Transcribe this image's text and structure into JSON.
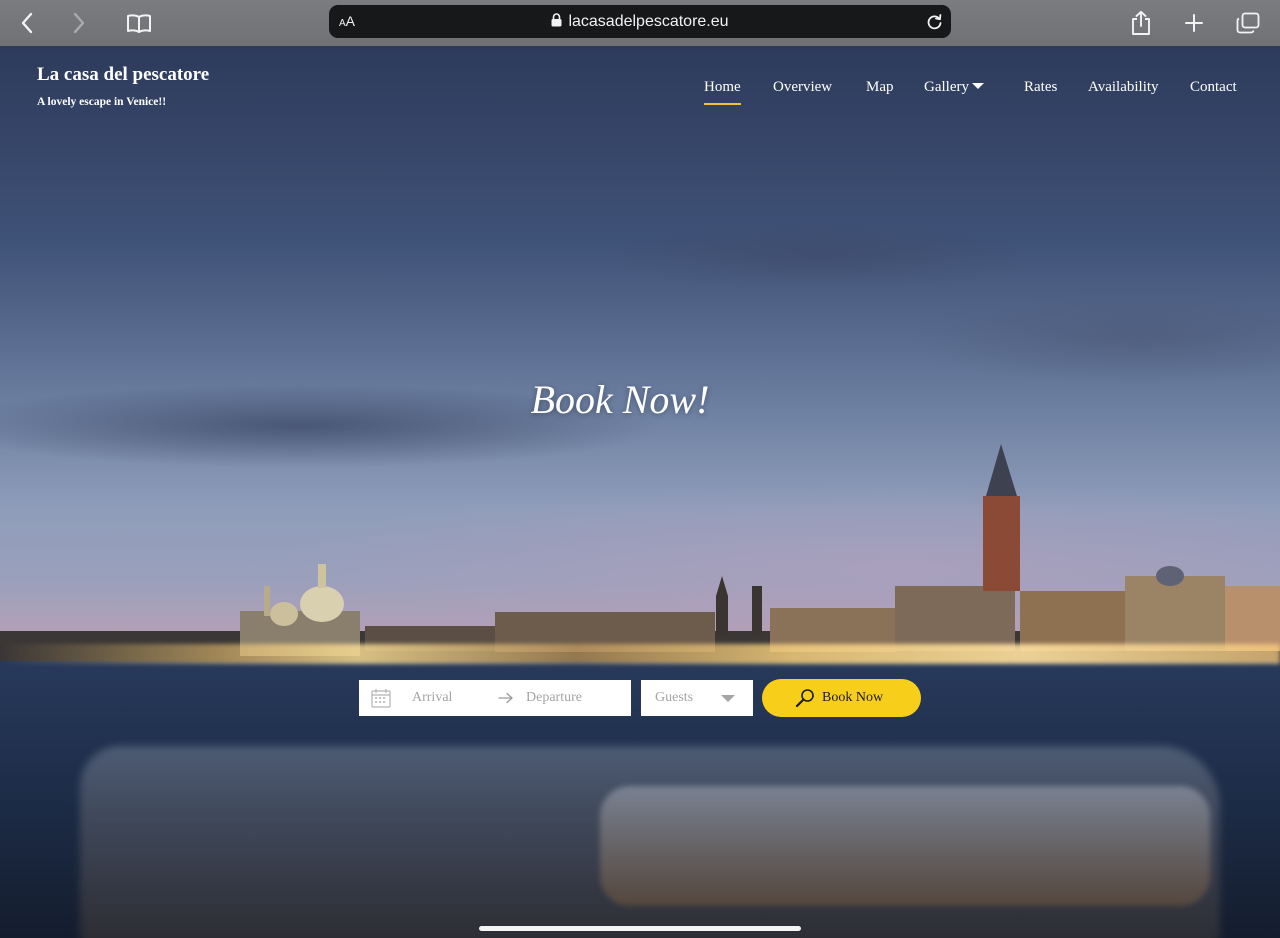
{
  "browser": {
    "text_size_label": "AA",
    "url": "lacasadelpescatore.eu"
  },
  "site": {
    "title": "La casa del pescatore",
    "tagline": "A lovely escape in Venice!!"
  },
  "nav": {
    "items": [
      {
        "label": "Home",
        "active": true
      },
      {
        "label": "Overview"
      },
      {
        "label": "Map"
      },
      {
        "label": "Gallery",
        "has_dropdown": true
      },
      {
        "label": "Rates"
      },
      {
        "label": "Availability"
      },
      {
        "label": "Contact"
      }
    ],
    "active_color": "#f1c232"
  },
  "hero": {
    "heading": "Book Now!"
  },
  "booking": {
    "arrival_placeholder": "Arrival",
    "departure_placeholder": "Departure",
    "guests_placeholder": "Guests",
    "button_label": "Book Now",
    "button_color": "#f7cf1a"
  }
}
